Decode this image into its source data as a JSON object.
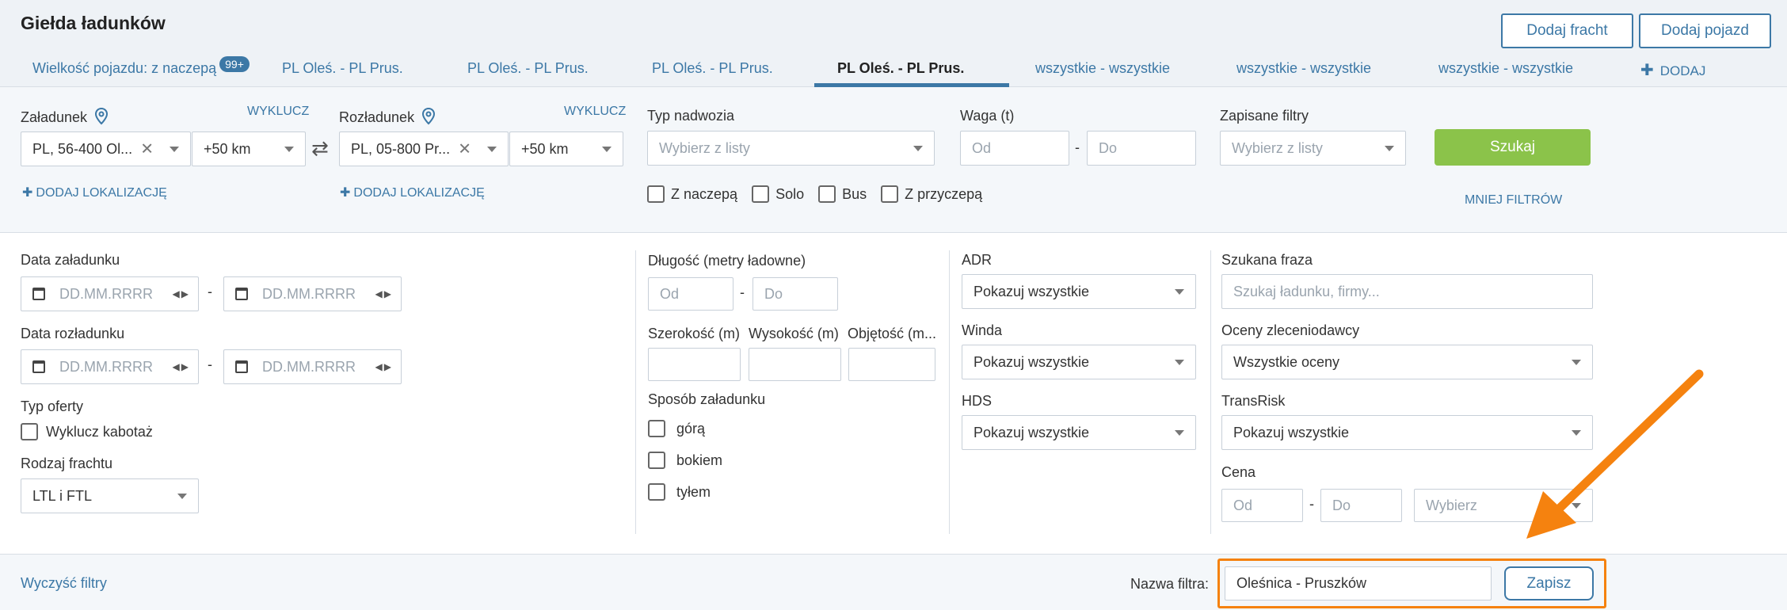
{
  "header": {
    "title": "Giełda ładunków",
    "add_freight": "Dodaj fracht",
    "add_vehicle": "Dodaj pojazd"
  },
  "tabs": [
    {
      "label": "Wielkość pojazdu: z naczepą",
      "badge": "99+"
    },
    {
      "label": "PL Oleś. - PL Prus."
    },
    {
      "label": "PL Oleś. - PL Prus."
    },
    {
      "label": "PL Oleś. - PL Prus."
    },
    {
      "label": "PL Oleś. - PL Prus.",
      "active": true
    },
    {
      "label": "wszystkie - wszystkie"
    },
    {
      "label": "wszystkie - wszystkie"
    },
    {
      "label": "wszystkie - wszystkie"
    },
    {
      "label": "DODAJ"
    }
  ],
  "loading": {
    "label": "Załadunek",
    "exclude": "WYKLUCZ",
    "location": "PL, 56-400 Ol...",
    "radius": "+50 km",
    "add_location": "DODAJ LOKALIZACJĘ"
  },
  "unloading": {
    "label": "Rozładunek",
    "exclude": "WYKLUCZ",
    "location": "PL, 05-800 Pr...",
    "radius": "+50 km",
    "add_location": "DODAJ LOKALIZACJĘ"
  },
  "body_type": {
    "label": "Typ nadwozia",
    "placeholder": "Wybierz z listy",
    "options": [
      "Z naczepą",
      "Solo",
      "Bus",
      "Z przyczepą"
    ]
  },
  "weight": {
    "label": "Waga (t)",
    "from": "Od",
    "to": "Do"
  },
  "saved_filters": {
    "label": "Zapisane filtry",
    "placeholder": "Wybierz z listy"
  },
  "search_button": "Szukaj",
  "less_filters": "MNIEJ FILTRÓW",
  "loading_date": {
    "label": "Data załadunku",
    "placeholder": "DD.MM.RRRR"
  },
  "unloading_date": {
    "label": "Data rozładunku",
    "placeholder": "DD.MM.RRRR"
  },
  "offer_type": {
    "label": "Typ oferty",
    "exclude_cabotage": "Wyklucz kabotaż"
  },
  "freight_kind": {
    "label": "Rodzaj frachtu",
    "value": "LTL i FTL"
  },
  "length": {
    "label": "Długość (metry ładowne)",
    "from": "Od",
    "to": "Do"
  },
  "width_label": "Szerokość (m)",
  "height_label": "Wysokość (m)",
  "volume_label": "Objętość (m...",
  "loading_method": {
    "label": "Sposób załadunku",
    "options": [
      "górą",
      "bokiem",
      "tyłem"
    ]
  },
  "adr": {
    "label": "ADR",
    "value": "Pokazuj wszystkie"
  },
  "lift": {
    "label": "Winda",
    "value": "Pokazuj wszystkie"
  },
  "hds": {
    "label": "HDS",
    "value": "Pokazuj wszystkie"
  },
  "search_phrase": {
    "label": "Szukana fraza",
    "placeholder": "Szukaj ładunku, firmy..."
  },
  "ratings": {
    "label": "Oceny zleceniodawcy",
    "value": "Wszystkie oceny"
  },
  "transrisk": {
    "label": "TransRisk",
    "value": "Pokazuj wszystkie"
  },
  "price": {
    "label": "Cena",
    "from": "Od",
    "to": "Do",
    "currency_placeholder": "Wybierz"
  },
  "footer": {
    "clear_filters": "Wyczyść filtry",
    "filter_name_label": "Nazwa filtra:",
    "filter_name_value": "Oleśnica - Pruszków",
    "save": "Zapisz"
  },
  "colors": {
    "accent": "#3c78a6",
    "search_green": "#8bc34a",
    "highlight_orange": "#f5820f"
  }
}
